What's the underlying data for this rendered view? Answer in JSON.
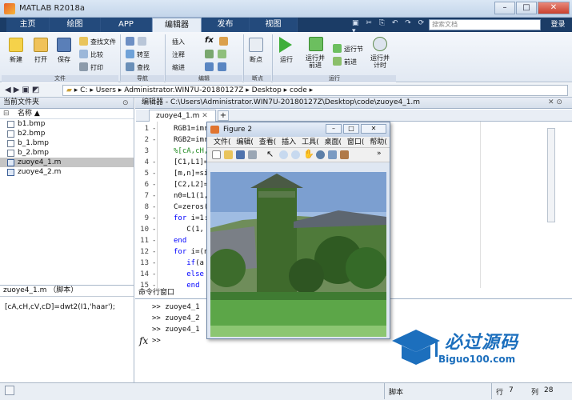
{
  "window": {
    "title": "MATLAB R2018a",
    "min": "–",
    "max": "□",
    "close": "✕"
  },
  "tabs": [
    {
      "label": "主页"
    },
    {
      "label": "绘图"
    },
    {
      "label": "APP"
    },
    {
      "label": "编辑器"
    },
    {
      "label": "发布"
    },
    {
      "label": "视图"
    }
  ],
  "search": {
    "placeholder": "搜索文档"
  },
  "login": "登录",
  "ribbon": {
    "file": {
      "new": "新建",
      "open": "打开",
      "save": "保存",
      "find_files": "查找文件",
      "compare": "比较",
      "print": "打印",
      "section": "文件"
    },
    "nav": {
      "goto": "转至",
      "find": "查找",
      "section": "导航"
    },
    "edit": {
      "insert": "插入",
      "comment": "注释",
      "indent": "缩进",
      "fx": "fx",
      "section": "编辑"
    },
    "breakpoints": {
      "label": "断点",
      "section": "断点"
    },
    "run": {
      "run": "运行",
      "run_advance": "运行并\n前进",
      "run_section": "运行节",
      "advance": "前进",
      "run_time": "运行并\n计时",
      "section": "运行"
    }
  },
  "address": {
    "parts": [
      "C:",
      "Users",
      "Administrator.WIN7U-20180127Z",
      "Desktop",
      "code"
    ]
  },
  "file_panel": {
    "title": "当前文件夹",
    "col_name": "名称 ▲",
    "files": [
      "b1.bmp",
      "b2.bmp",
      "b_1.bmp",
      "b_2.bmp",
      "zuoye4_1.m",
      "zuoye4_2.m"
    ],
    "selected": 4
  },
  "details": {
    "title": "zuoye4_1.m （脚本）",
    "code": "[cA,cH,cV,cD]=dwt2(I1,'haar');"
  },
  "editor": {
    "title": "编辑器 - C:\\Users\\Administrator.WIN7U-20180127Z\\Desktop\\code\\zuoye4_1.m",
    "tab": "zuoye4_1.m",
    "add": "+",
    "lines": [
      {
        "n": "1",
        "d": "-",
        "t": "RGB1=imr"
      },
      {
        "n": "2",
        "d": "-",
        "t": "RGB2=imr"
      },
      {
        "n": "3",
        "d": "",
        "t": "%[cA,cH,"
      },
      {
        "n": "4",
        "d": "-",
        "t": "[C1,L1]="
      },
      {
        "n": "5",
        "d": "-",
        "t": "[m,n]=si"
      },
      {
        "n": "6",
        "d": "-",
        "t": "[C2,L2]="
      },
      {
        "n": "7",
        "d": "-",
        "t": "n0=L1(1,"
      },
      {
        "n": "8",
        "d": "-",
        "t": "C=zeros("
      },
      {
        "n": "9",
        "d": "-",
        "t": "for i=1:"
      },
      {
        "n": "10",
        "d": "-",
        "t": "   C(1,"
      },
      {
        "n": "11",
        "d": "-",
        "t": "end"
      },
      {
        "n": "12",
        "d": "-",
        "t": "for i=(n"
      },
      {
        "n": "13",
        "d": "-",
        "t": "   if(a"
      },
      {
        "n": "14",
        "d": "-",
        "t": "   else"
      },
      {
        "n": "15",
        "d": "-",
        "t": "   end"
      }
    ]
  },
  "command": {
    "title": "命令行窗口",
    "lines": [
      ">> zuoye4_1",
      ">> zuoye4_2",
      ">> zuoye4_1"
    ],
    "prompt": ">>",
    "fx": "fx"
  },
  "status": {
    "mode": "脚本",
    "row_label": "行",
    "row": "7",
    "col_label": "列",
    "col": "28"
  },
  "figure": {
    "title": "Figure 2",
    "menus": [
      "文件(",
      "编辑(",
      "查看(",
      "插入",
      "工具(",
      "桌面(",
      "窗口(",
      "帮助("
    ]
  },
  "watermark": {
    "text": "必过源码",
    "url": "Biguo100.com"
  }
}
